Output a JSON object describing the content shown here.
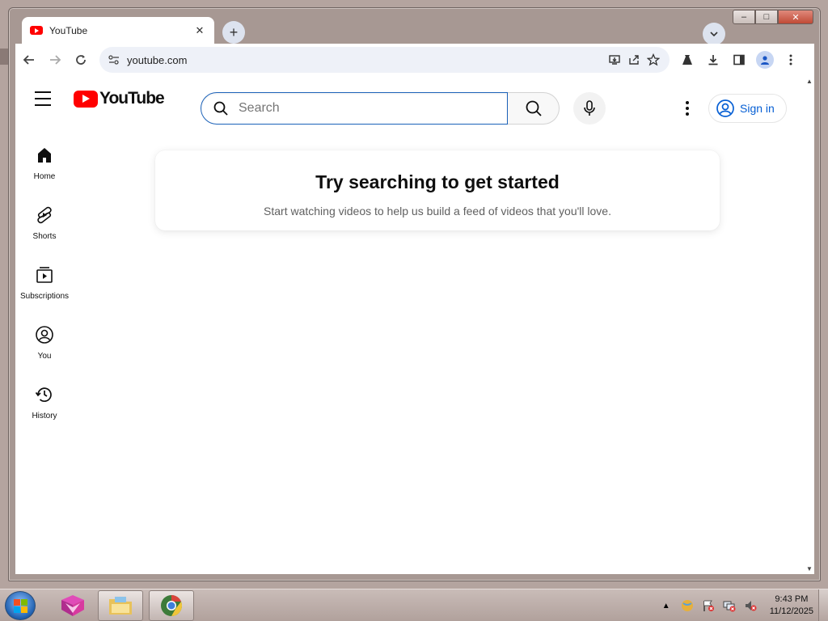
{
  "window": {
    "minimize_label": "–",
    "maximize_label": "□",
    "close_label": "✕"
  },
  "browser": {
    "tab": {
      "title": "YouTube",
      "close_label": "✕"
    },
    "newtab_label": "+",
    "tab_search_label": "⌄",
    "url": "youtube.com",
    "nav": {
      "back": "←",
      "forward": "→",
      "reload": "↻"
    },
    "toolbar_icons": [
      "install-app-icon",
      "share-icon",
      "bookmark-star-icon",
      "labs-flask-icon",
      "download-icon",
      "side-panel-icon",
      "profile-icon",
      "menu-kebab-icon"
    ]
  },
  "youtube": {
    "logo_text": "YouTube",
    "search": {
      "placeholder": "Search"
    },
    "sign_in_label": "Sign in",
    "guide": [
      {
        "label": "Home",
        "icon": "home-icon"
      },
      {
        "label": "Shorts",
        "icon": "shorts-icon"
      },
      {
        "label": "Subscriptions",
        "icon": "subscriptions-icon"
      },
      {
        "label": "You",
        "icon": "you-icon"
      },
      {
        "label": "History",
        "icon": "history-icon"
      }
    ],
    "promo": {
      "title": "Try searching to get started",
      "subtitle": "Start watching videos to help us build a feed of videos that you'll love."
    }
  },
  "taskbar": {
    "apps": [
      "app-launcher-icon",
      "file-explorer-icon",
      "chrome-icon"
    ],
    "clock": {
      "time": "9:43 PM",
      "date": "11/12/2025"
    }
  },
  "colors": {
    "accent_blue": "#065fd4",
    "youtube_red": "#ff0000",
    "search_focus": "#1c62b9"
  }
}
